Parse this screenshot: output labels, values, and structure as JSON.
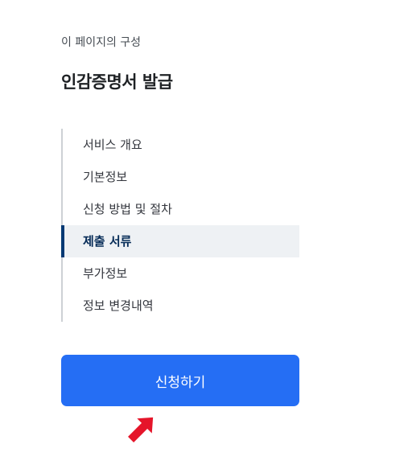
{
  "toc": {
    "caption": "이 페이지의 구성",
    "heading": "인감증명서 발급",
    "items": [
      {
        "label": "서비스 개요"
      },
      {
        "label": "기본정보"
      },
      {
        "label": "신청 방법 및 절차"
      },
      {
        "label": "제출 서류",
        "active": true
      },
      {
        "label": "부가정보"
      },
      {
        "label": "정보 변경내역"
      }
    ]
  },
  "apply": {
    "label": "신청하기"
  },
  "colors": {
    "primary": "#256ef4",
    "active_indicator": "#063a74",
    "active_bg": "#eef1f4",
    "pointer": "#e5152a"
  },
  "icons": {
    "pointer": "arrow-pointer-icon"
  }
}
